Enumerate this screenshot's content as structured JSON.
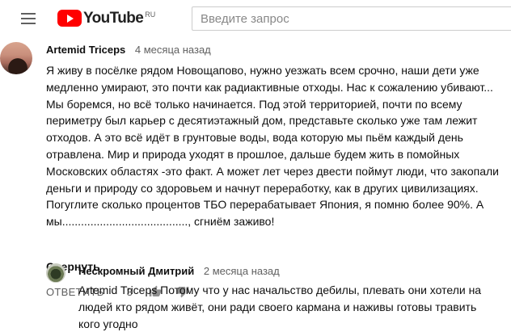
{
  "header": {
    "logo_text": "YouTube",
    "region": "RU",
    "search_placeholder": "Введите запрос"
  },
  "comment": {
    "author": "Artemid Triceps",
    "time": "4 месяца назад",
    "text": "Я живу в посёлке рядом Новощапово, нужно уезжать всем срочно, наши дети уже медленно умирают, это почти как радиактивные отходы. Нас к сожалению убивают... Мы боремся, но всё только начинается. Под этой территорией, почти по всему периметру был карьер с десятиэтажный дом, представьте сколько уже там лежит отходов. А это всё идёт в грунтовые воды, вода которую мы пьём каждый день отравлена. Мир и природа уходят в прошлое, дальше будем жить в помойных Московских областях -это факт. А может лет через двести поймут люди, что закопали деньги и природу со здоровьем и начнут переработку, как в других цивилизациях. Погуглите сколько процентов ТБО перерабатывает Япония, я помню более 90%. А мы........................................, сгниём заживо!",
    "collapse_label": "Свернуть",
    "reply_label": "ОТВЕТИТЬ",
    "like_count": "3",
    "like_icon": "thumb-up-icon",
    "dislike_icon": "thumb-down-icon"
  },
  "reply": {
    "author": "Нескромный Дмитрий",
    "time": "2 месяца назад",
    "text": "Artemid Triceps Потому что у нас начальство дебилы, плевать они хотели на людей кто рядом живёт, они ради своего кармана и наживы готовы травить кого угодно"
  },
  "colors": {
    "brand_red": "#ff0000",
    "secondary_text": "#606060"
  }
}
